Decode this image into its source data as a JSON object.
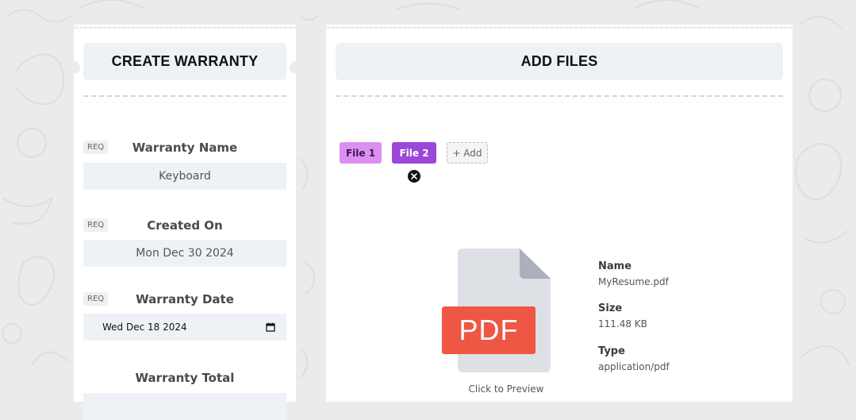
{
  "left_panel": {
    "title": "CREATE WARRANTY",
    "fields": [
      {
        "req": "REQ",
        "label": "Warranty Name",
        "value": "Keyboard"
      },
      {
        "req": "REQ",
        "label": "Created On",
        "value": "Mon Dec 30 2024"
      },
      {
        "req": "REQ",
        "label": "Warranty Date",
        "value": "Wed Dec 18 2024"
      },
      {
        "label": "Warranty Total"
      }
    ]
  },
  "right_panel": {
    "title": "ADD FILES",
    "tabs": [
      {
        "label": "File 1",
        "color": "#dc8ff0"
      },
      {
        "label": "File 2",
        "color": "#9b47d9",
        "active": true
      }
    ],
    "add_label": "+ Add",
    "preview": {
      "file_badge": "PDF",
      "click_label": "Click to Preview",
      "name_label": "Name",
      "name_value": "MyResume.pdf",
      "size_label": "Size",
      "size_value": "111.48 KB",
      "type_label": "Type",
      "type_value": "application/pdf"
    }
  },
  "colors": {
    "background": "#ebebeb",
    "card": "#ffffff",
    "field_bg": "#eef2f7",
    "pdf_red": "#ef5745"
  }
}
